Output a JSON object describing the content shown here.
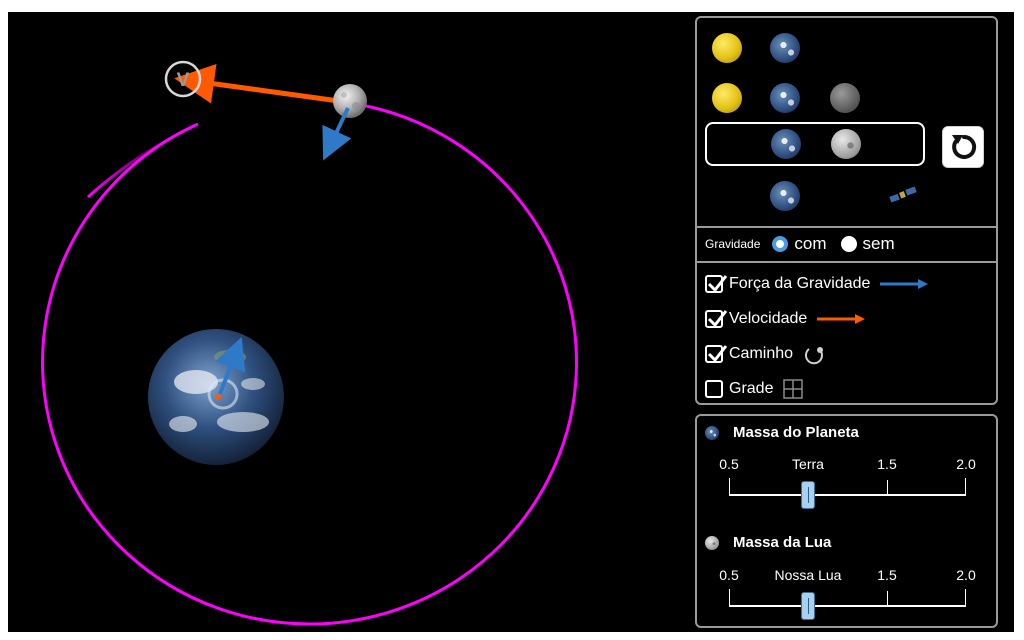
{
  "bodies": {
    "presets": [
      {
        "name": "sun-earth",
        "icons": [
          "sun",
          "earth"
        ]
      },
      {
        "name": "sun-earth-moon",
        "icons": [
          "sun",
          "earth",
          "moon"
        ]
      },
      {
        "name": "earth-moon",
        "icons": [
          "earth",
          "moon"
        ],
        "selected": true
      },
      {
        "name": "earth-satellite",
        "icons": [
          "earth",
          "satellite"
        ]
      }
    ],
    "reset_icon": "reset-icon"
  },
  "gravity": {
    "label": "Gravidade",
    "on_label": "com",
    "off_label": "sem",
    "selected": "com"
  },
  "options": {
    "gravity_force": {
      "label": "Força da Gravidade",
      "checked": true,
      "color": "#2f79c9"
    },
    "velocity": {
      "label": "Velocidade",
      "checked": true,
      "color": "#ff5a00"
    },
    "path": {
      "label": "Caminho",
      "checked": true
    },
    "grid": {
      "label": "Grade",
      "checked": false
    }
  },
  "planet_mass": {
    "title": "Massa do Planeta",
    "ticks": [
      "0.5",
      "Terra",
      "1.5",
      "2.0"
    ],
    "value_fraction": 0.333
  },
  "moon_mass": {
    "title": "Massa da Lua",
    "ticks": [
      "0.5",
      "Nossa Lua",
      "1.5",
      "2.0"
    ],
    "value_fraction": 0.333
  },
  "scene": {
    "velocity_marker": "V",
    "orbit_color": "#ff00ff",
    "velocity_color": "#ff5a00",
    "force_color": "#2f79c9"
  }
}
